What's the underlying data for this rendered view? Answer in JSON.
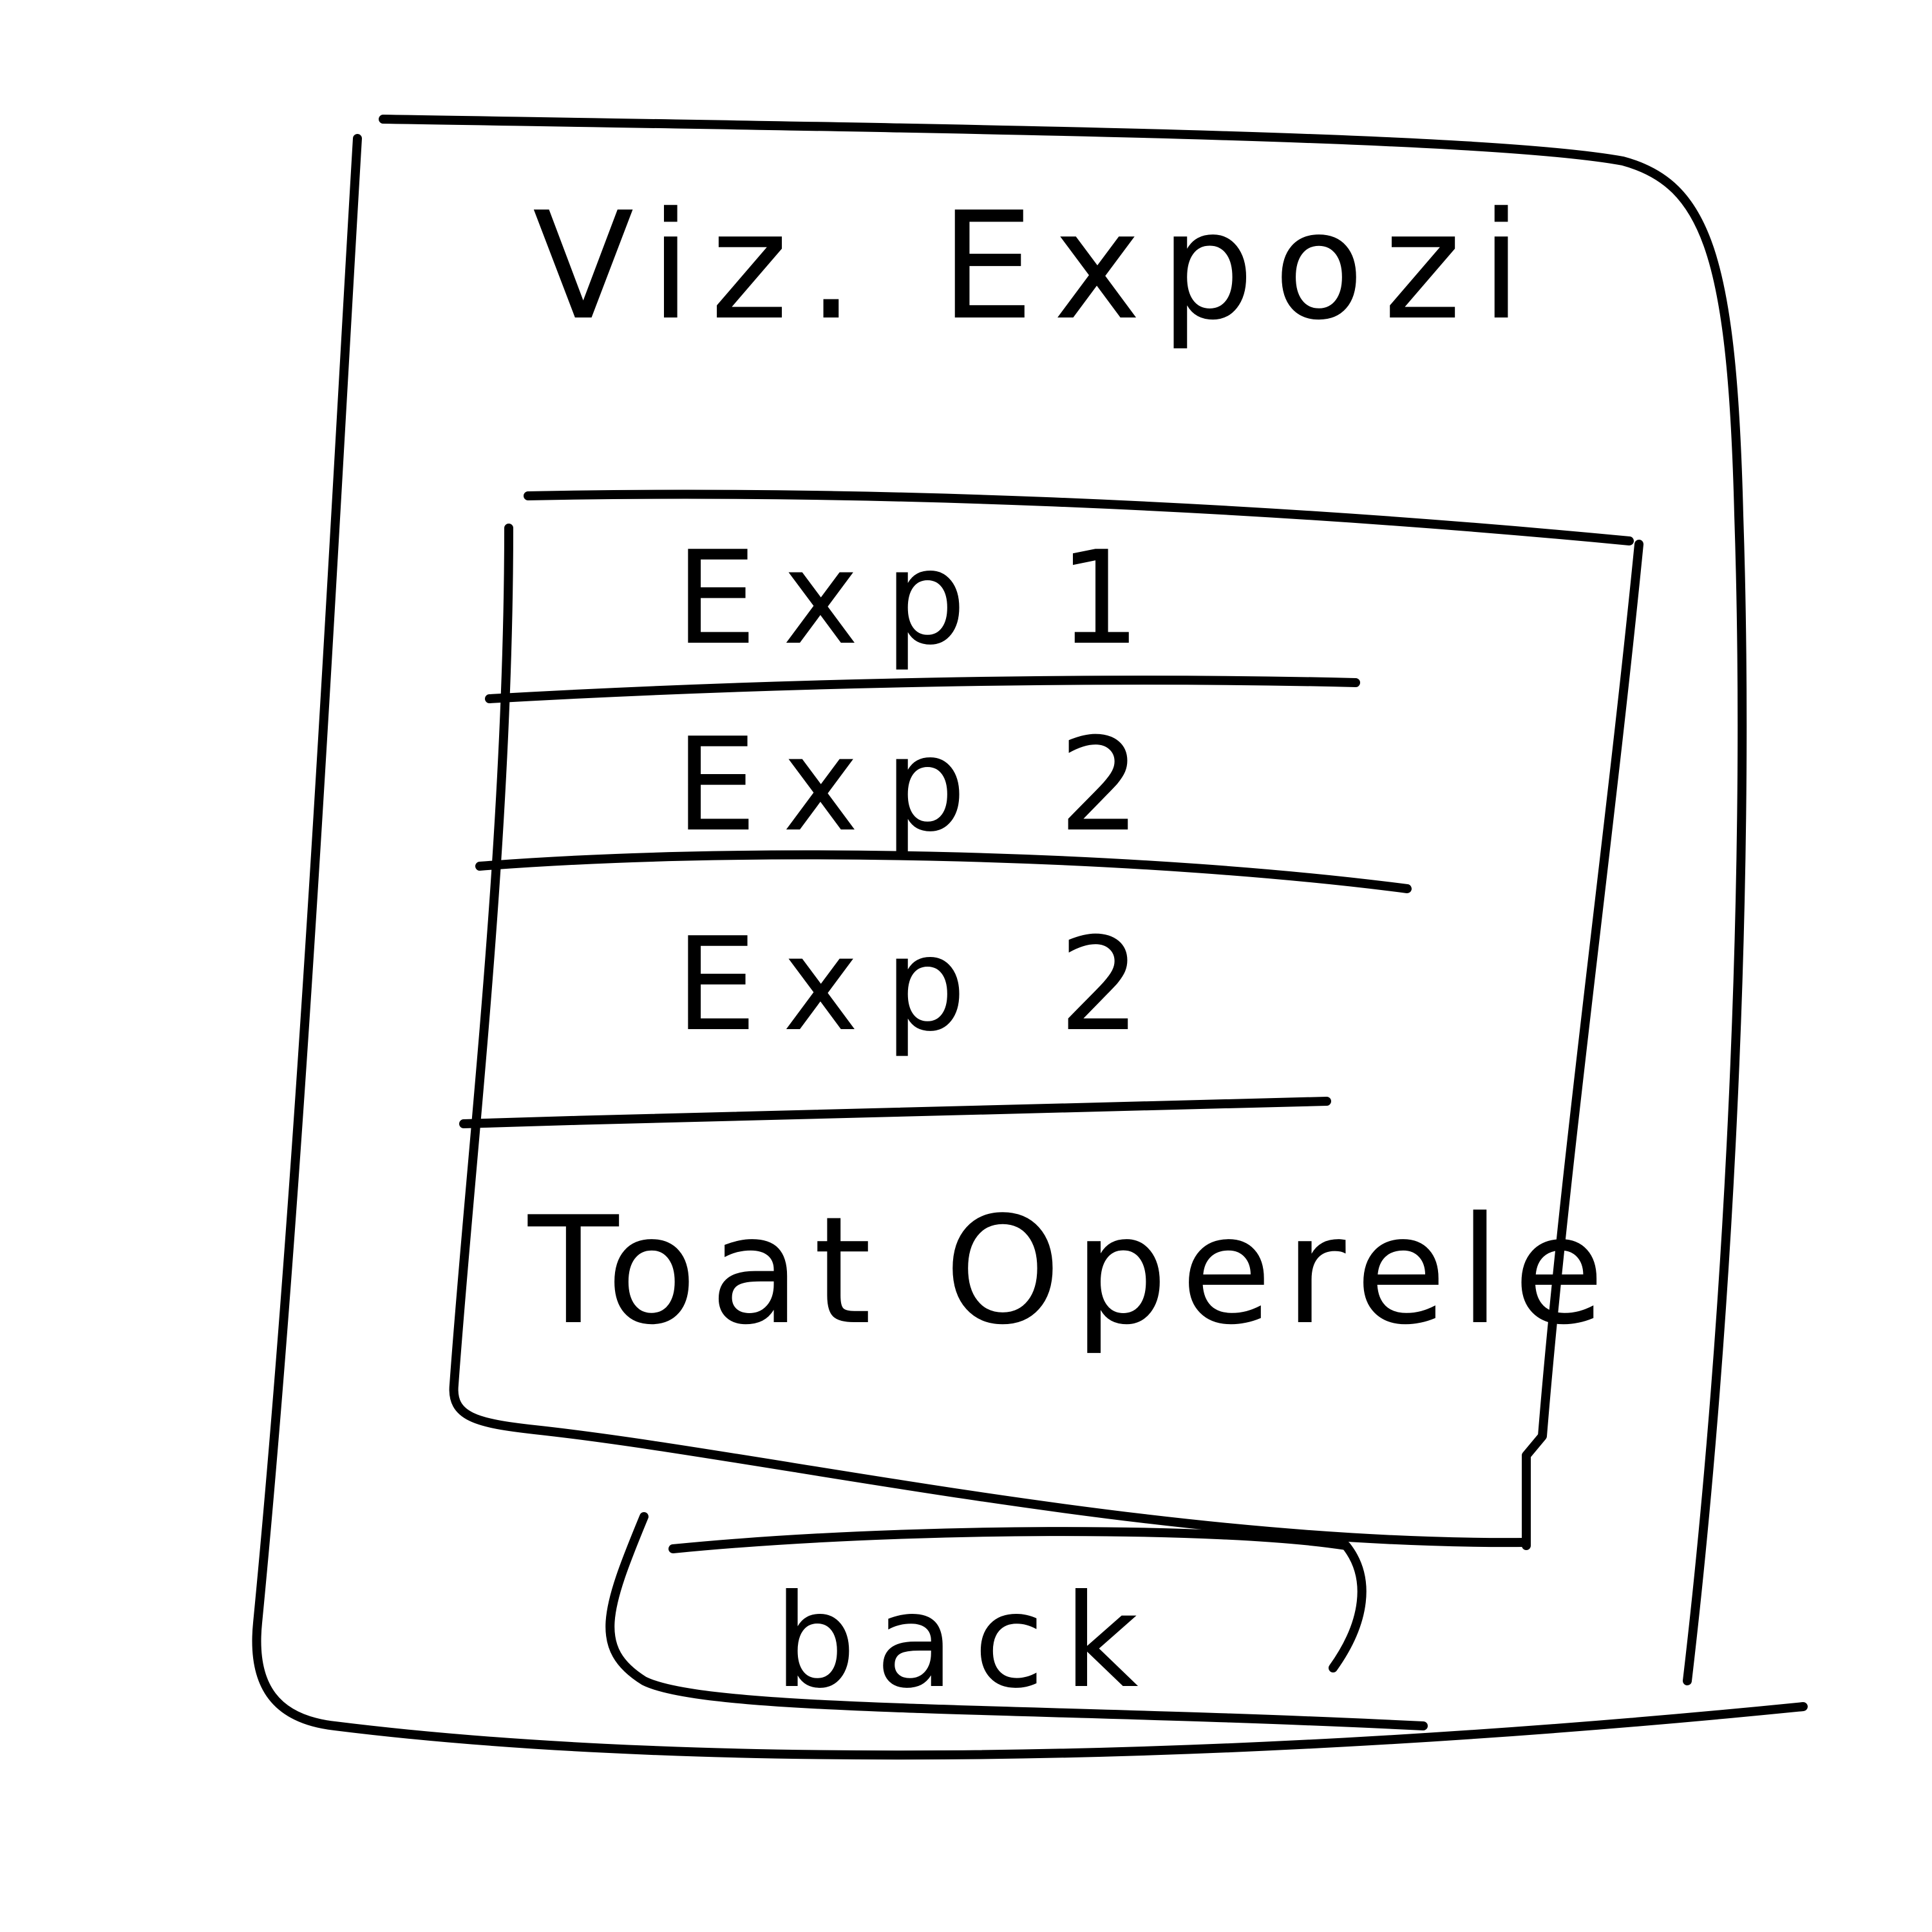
{
  "screen": {
    "title": "Viz. Expozi"
  },
  "list": {
    "items": [
      {
        "label": "Exp 1"
      },
      {
        "label": "Exp 2"
      },
      {
        "label": "Exp 2"
      },
      {
        "label": "Toat Operele"
      }
    ]
  },
  "footer": {
    "back_label": "back"
  }
}
